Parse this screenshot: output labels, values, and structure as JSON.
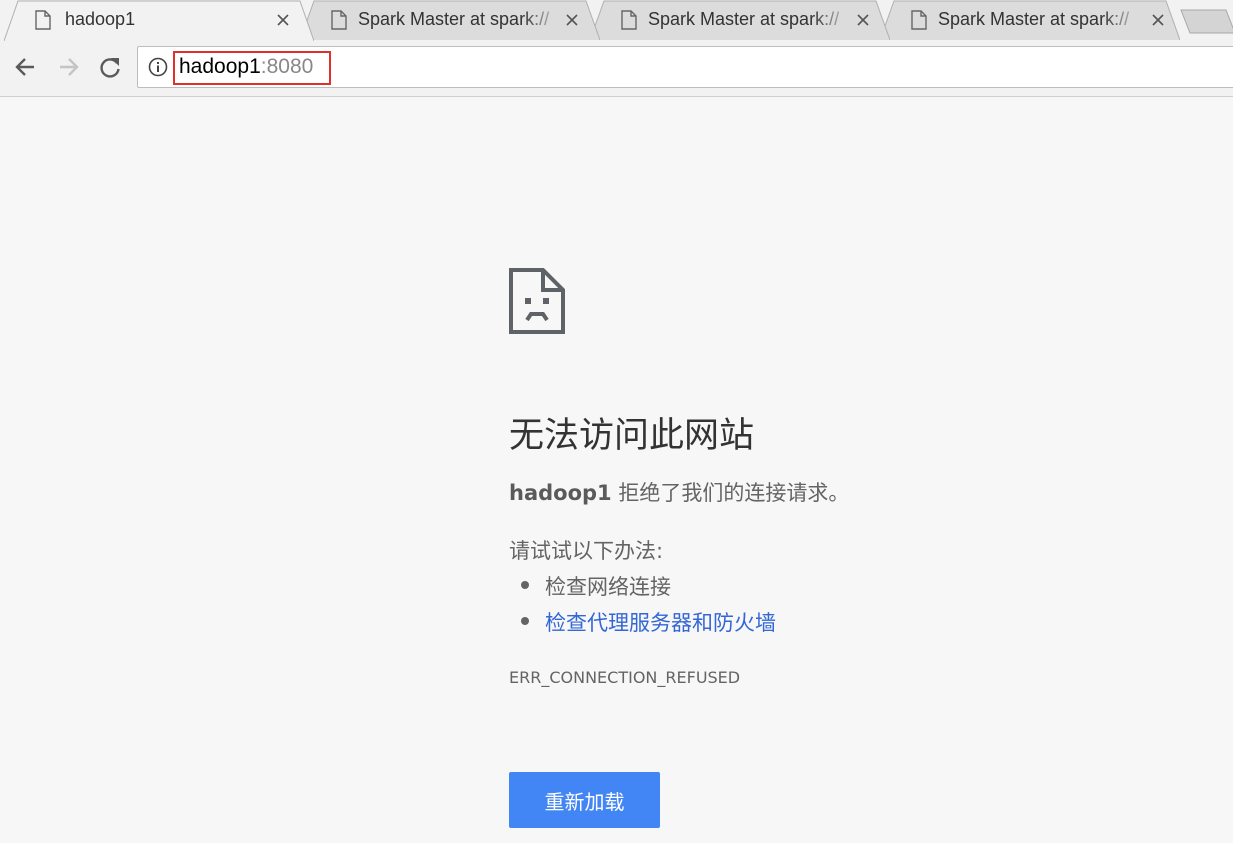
{
  "browser": {
    "tabs": [
      {
        "title": "hadoop1",
        "active": true
      },
      {
        "title": "Spark Master at spark://",
        "active": false
      },
      {
        "title": "Spark Master at spark://",
        "active": false
      },
      {
        "title": "Spark Master at spark://",
        "active": false
      }
    ],
    "address": {
      "host": "hadoop1",
      "port": ":8080"
    }
  },
  "error_page": {
    "heading": "无法访问此网站",
    "host": "hadoop1",
    "message": " 拒绝了我们的连接请求。",
    "try_label": "请试试以下办法:",
    "suggestions": [
      "检查网络连接",
      "检查代理服务器和防火墙"
    ],
    "error_code": "ERR_CONNECTION_REFUSED",
    "reload_label": "重新加载"
  },
  "colors": {
    "reload_button": "#4285f4",
    "link": "#3367d6",
    "highlight_box": "#e0302b"
  }
}
